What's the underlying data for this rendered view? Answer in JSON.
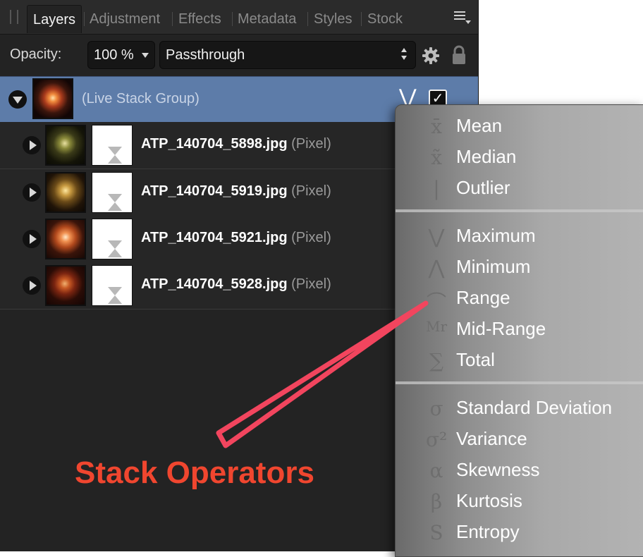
{
  "tabs": [
    {
      "label": "Layers",
      "active": true
    },
    {
      "label": "Adjustment",
      "active": false
    },
    {
      "label": "Effects",
      "active": false
    },
    {
      "label": "Metadata",
      "active": false
    },
    {
      "label": "Styles",
      "active": false
    },
    {
      "label": "Stock",
      "active": false
    }
  ],
  "controls": {
    "opacity_label": "Opacity:",
    "opacity_value": "100 %",
    "blend_mode": "Passthrough"
  },
  "group": {
    "label": "(Live Stack Group)",
    "operator_symbol": "⋁",
    "checked_mark": "✓"
  },
  "layers": [
    {
      "name": "ATP_140704_5898.jpg",
      "kind": "(Pixel)"
    },
    {
      "name": "ATP_140704_5919.jpg",
      "kind": "(Pixel)"
    },
    {
      "name": "ATP_140704_5921.jpg",
      "kind": "(Pixel)"
    },
    {
      "name": "ATP_140704_5928.jpg",
      "kind": "(Pixel)"
    }
  ],
  "menu": {
    "items": [
      {
        "label": "Mean",
        "icon": "x̄"
      },
      {
        "label": "Median",
        "icon": "x̃"
      },
      {
        "label": "Outlier",
        "icon": "|"
      },
      {
        "label": "Maximum",
        "icon": "⋁"
      },
      {
        "label": "Minimum",
        "icon": "⋀"
      },
      {
        "label": "Range",
        "icon": "⌒"
      },
      {
        "label": "Mid-Range",
        "icon": "Mr"
      },
      {
        "label": "Total",
        "icon": "∑"
      },
      {
        "label": "Standard Deviation",
        "icon": "σ"
      },
      {
        "label": "Variance",
        "icon": "σ²"
      },
      {
        "label": "Skewness",
        "icon": "α"
      },
      {
        "label": "Kurtosis",
        "icon": "β"
      },
      {
        "label": "Entropy",
        "icon": "S"
      }
    ]
  },
  "annotation": {
    "text": "Stack Operators"
  },
  "colors": {
    "selection": "#5d7ca9",
    "annotation": "#f0462f",
    "panel": "#232323"
  }
}
